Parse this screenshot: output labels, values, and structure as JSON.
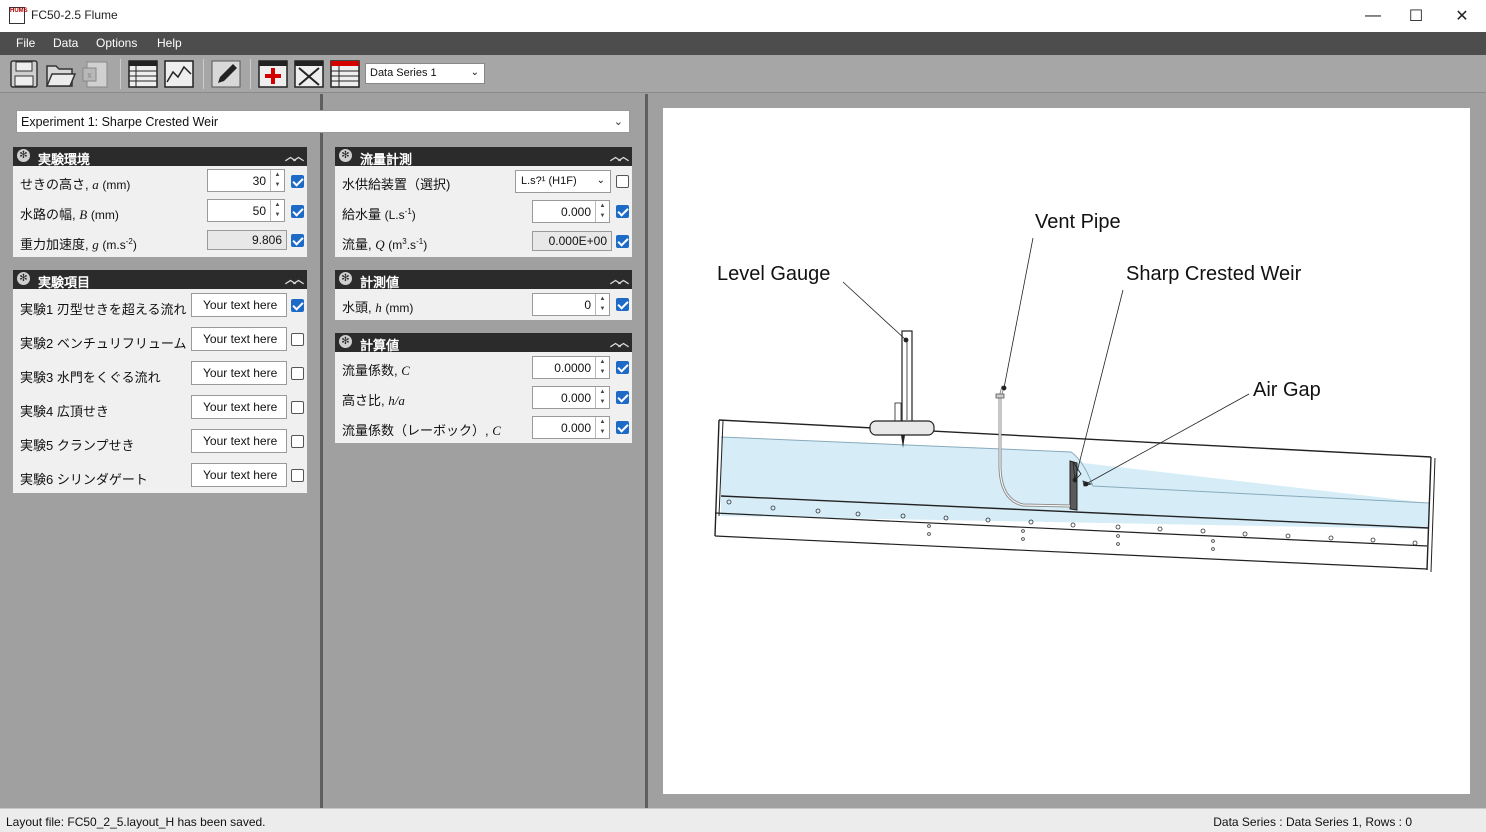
{
  "window": {
    "logo_text": "HUMS",
    "title": "FC50-2.5 Flume",
    "minimize": "—",
    "maximize": "☐",
    "close": "✕"
  },
  "menu": {
    "file": "File",
    "data": "Data",
    "options": "Options",
    "help": "Help"
  },
  "toolbar": {
    "icons": [
      "save-icon",
      "open-folder-icon",
      "excel-export-icon",
      "table-view-icon",
      "chart-view-icon",
      "pencil-icon",
      "add-row-icon",
      "delete-row-icon",
      "table-settings-icon"
    ],
    "data_series": "Data Series 1"
  },
  "experiment": {
    "selected": "Experiment 1: Sharpe Crested Weir"
  },
  "env_panel": {
    "title": "実験環境",
    "rows": [
      {
        "label": "せきの高さ",
        "symbol": "a",
        "unit": "(mm)",
        "value": "30",
        "checked": true
      },
      {
        "label": "水路の幅",
        "symbol": "B",
        "unit": "(mm)",
        "value": "50",
        "checked": true
      },
      {
        "label": "重力加速度",
        "symbol": "g",
        "unit_pre": "(m.s",
        "unit_sup": "-2",
        "unit_post": ")",
        "value": "9.806",
        "checked": true
      }
    ]
  },
  "items_panel": {
    "title": "実験項目",
    "rows": [
      {
        "label": "実験1  刃型せきを超える流れ",
        "text": "Your text here",
        "checked": true
      },
      {
        "label": "実験2  ベンチュリフリューム",
        "text": "Your text here",
        "checked": false
      },
      {
        "label": "実験3  水門をくぐる流れ",
        "text": "Your text here",
        "checked": false
      },
      {
        "label": "実験4  広頂せき",
        "text": "Your text here",
        "checked": false
      },
      {
        "label": "実験5  クランプせき",
        "text": "Your text here",
        "checked": false
      },
      {
        "label": "実験6  シリンダゲート",
        "text": "Your text here",
        "checked": false
      }
    ]
  },
  "flow_panel": {
    "title": "流量計測",
    "supply_label": "水供給装置（選択)",
    "supply_value": "L.s?¹ (H1F)",
    "supply_checked": false,
    "feed_label": "給水量",
    "feed_unit_pre": "(L.s",
    "feed_unit_sup": "-1",
    "feed_unit_post": ")",
    "feed_value": "0.000",
    "flow_label": "流量,",
    "flow_symbol": "Q",
    "flow_unit_pre": "(m",
    "flow_unit_sup1": "3",
    "flow_unit_mid": ".s",
    "flow_unit_sup2": "-1",
    "flow_unit_post": ")",
    "flow_value": "0.000E+00"
  },
  "measured_panel": {
    "title": "計測値",
    "head_label": "水頭,",
    "head_symbol": "h",
    "head_unit": "(mm)",
    "head_value": "0"
  },
  "calc_panel": {
    "title": "計算値",
    "rows": [
      {
        "label": "流量係数,",
        "symbol": "C",
        "value": "0.0000"
      },
      {
        "label": "高さ比,",
        "symbol": "h/a",
        "value": "0.000"
      },
      {
        "label": "流量係数（レーボック）,",
        "symbol": "C",
        "value": "0.000"
      }
    ]
  },
  "diagram": {
    "labels": {
      "vent_pipe": "Vent Pipe",
      "level_gauge": "Level Gauge",
      "sharp_crested_weir": "Sharp Crested Weir",
      "air_gap": "Air Gap"
    }
  },
  "status": {
    "left": "Layout file: FC50_2_5.layout_H has been saved.",
    "right": "Data Series : Data Series 1,   Rows : 0"
  }
}
